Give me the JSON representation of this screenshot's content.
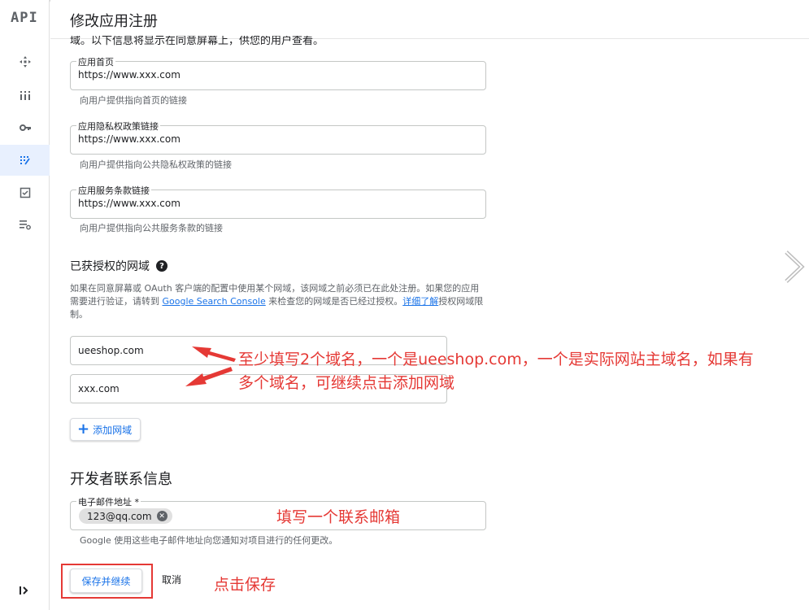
{
  "app": {
    "logo": "API",
    "title": "修改应用注册"
  },
  "sidebar": {
    "items": [
      {
        "icon": "dashboard-icon"
      },
      {
        "icon": "library-icon"
      },
      {
        "icon": "key-icon"
      },
      {
        "icon": "oauth-consent-icon",
        "active": true
      },
      {
        "icon": "domain-verification-icon"
      },
      {
        "icon": "settings-list-icon"
      }
    ],
    "collapse_icon": "collapse-icon"
  },
  "intro_cut": "域。以下信息将显示在同意屏幕上，供您的用户查看。",
  "fields": {
    "homepage": {
      "label": "应用首页",
      "value": "https://www.xxx.com",
      "helper": "向用户提供指向首页的链接"
    },
    "privacy": {
      "label": "应用隐私权政策链接",
      "value": "https://www.xxx.com",
      "helper": "向用户提供指向公共隐私权政策的链接"
    },
    "tos": {
      "label": "应用服务条款链接",
      "value": "https://www.xxx.com",
      "helper": "向用户提供指向公共服务条款的链接"
    }
  },
  "authorized_domains": {
    "heading": "已获授权的网域",
    "desc_part1": "如果在同意屏幕或 OAuth 客户端的配置中使用某个网域，该网域之前必须已在此处注册。如果您的应用需要进行验证，请转到 ",
    "desc_link1": "Google Search Console",
    "desc_part2": " 来检查您的网域是否已经过授权。",
    "desc_link2": "详细了解",
    "desc_part3": "授权网域限制。",
    "domains": [
      "ueeshop.com",
      "xxx.com"
    ],
    "add_label": "添加网域"
  },
  "developer": {
    "heading": "开发者联系信息",
    "email_label": "电子邮件地址 *",
    "email_chip": "123@qq.com",
    "helper": "Google 使用这些电子邮件地址向您通知对项目进行的任何更改。"
  },
  "actions": {
    "save": "保存并继续",
    "cancel": "取消"
  },
  "annotations": {
    "domains_line1": "至少填写2个域名，一个是ueeshop.com，一个是实际网站主域名，如果有",
    "domains_line2": "多个域名，可继续点击添加网域",
    "email": "填写一个联系邮箱",
    "save": "点击保存"
  },
  "colors": {
    "accent": "#1a73e8",
    "annotation": "#e53935",
    "active_nav": "#e8f0fe"
  }
}
